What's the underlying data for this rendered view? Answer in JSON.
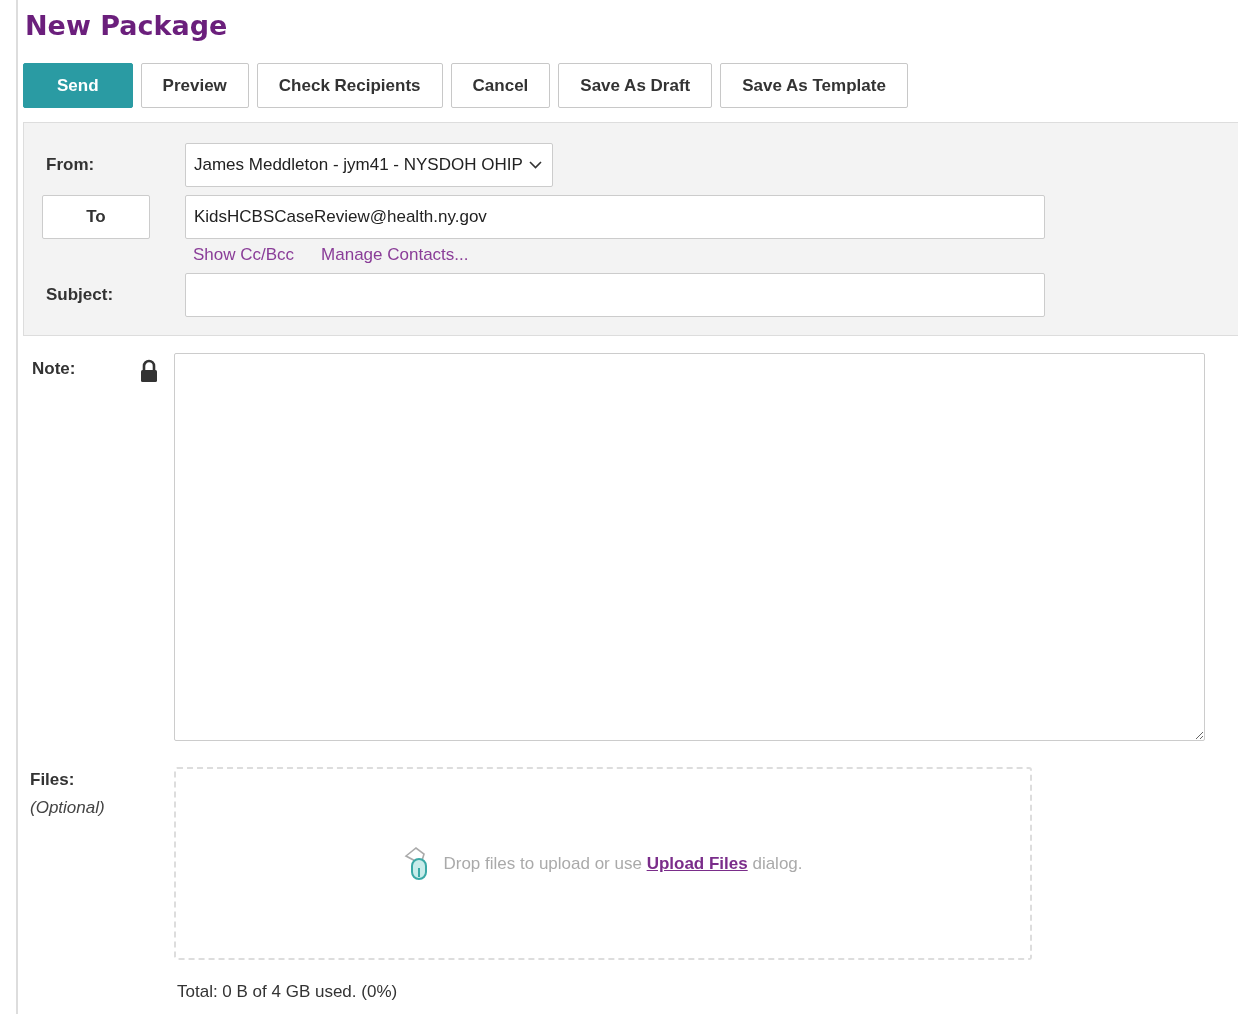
{
  "title": "New Package",
  "buttons": [
    {
      "label": "Send",
      "kind": "primary"
    },
    {
      "label": "Preview",
      "kind": "default"
    },
    {
      "label": "Check Recipients",
      "kind": "default"
    },
    {
      "label": "Cancel",
      "kind": "default"
    },
    {
      "label": "Save As Draft",
      "kind": "default"
    },
    {
      "label": "Save As Template",
      "kind": "default"
    }
  ],
  "from": {
    "label": "From:",
    "value": "James Meddleton - jym41 - NYSDOH OHIP"
  },
  "to": {
    "button": "To",
    "value": "KidsHCBSCaseReview@health.ny.gov"
  },
  "links": [
    "Show Cc/Bcc",
    "Manage Contacts..."
  ],
  "subject": {
    "label": "Subject:"
  },
  "note": {
    "label": "Note:",
    "locked": true
  },
  "files": {
    "label": "Files:",
    "hint": "(Optional)",
    "drop_before": "Drop files to upload or use",
    "drop_link": "Upload Files",
    "drop_after": "dialog.",
    "total": "Total: 0 B of 4 GB used. (0%)"
  }
}
